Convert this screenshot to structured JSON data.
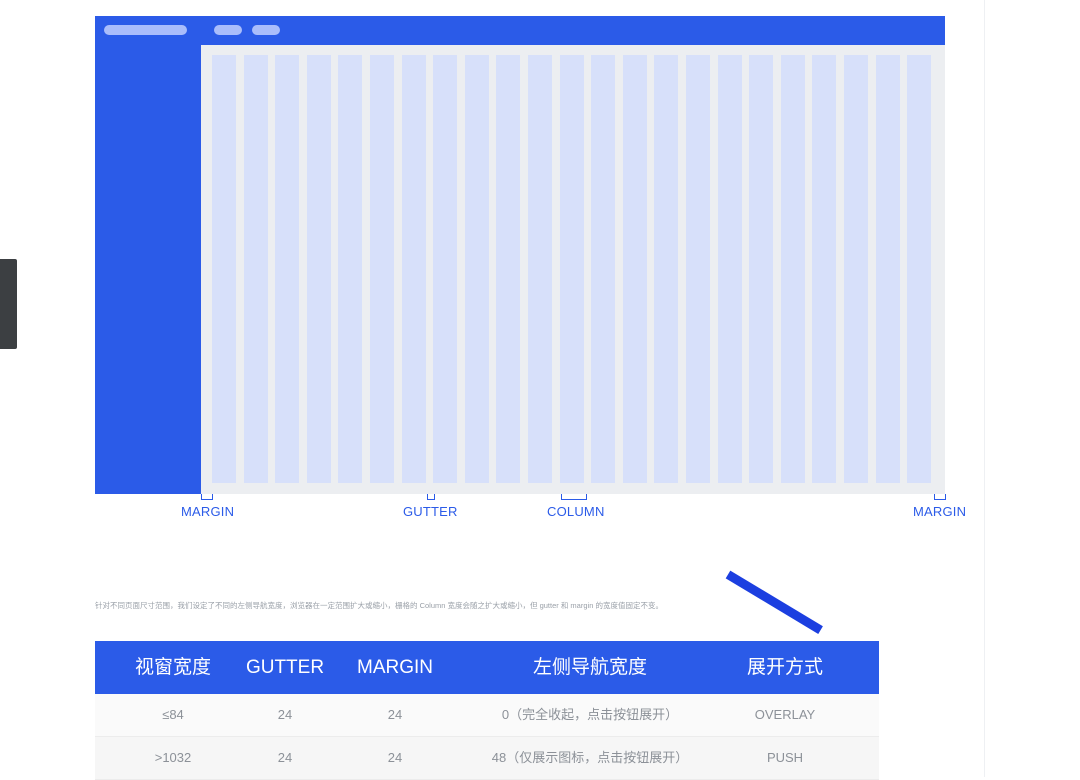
{
  "mock": {
    "column_count": 23,
    "colors": {
      "primary": "#2b5be8",
      "column": "#d7e0fa",
      "content_bg": "#eceef1",
      "pill": "#aabdfb"
    }
  },
  "labels": {
    "margin_left": "MARGIN",
    "gutter": "GUTTER",
    "column": "COLUMN",
    "margin_right": "MARGIN"
  },
  "caption": "针对不同页面尺寸范围，我们设定了不同的左侧导航宽度，浏览器在一定范围扩大或缩小，栅格的 Column 宽度会随之扩大或缩小，但 gutter 和 margin 的宽度值固定不变。",
  "table": {
    "headers": [
      "视窗宽度",
      "GUTTER",
      "MARGIN",
      "左侧导航宽度",
      "展开方式"
    ],
    "rows": [
      [
        "≤84",
        "24",
        "24",
        "0（完全收起，点击按钮展开）",
        "OVERLAY"
      ],
      [
        ">1032",
        "24",
        "24",
        "48（仅展示图标，点击按钮展开）",
        "PUSH"
      ]
    ]
  }
}
